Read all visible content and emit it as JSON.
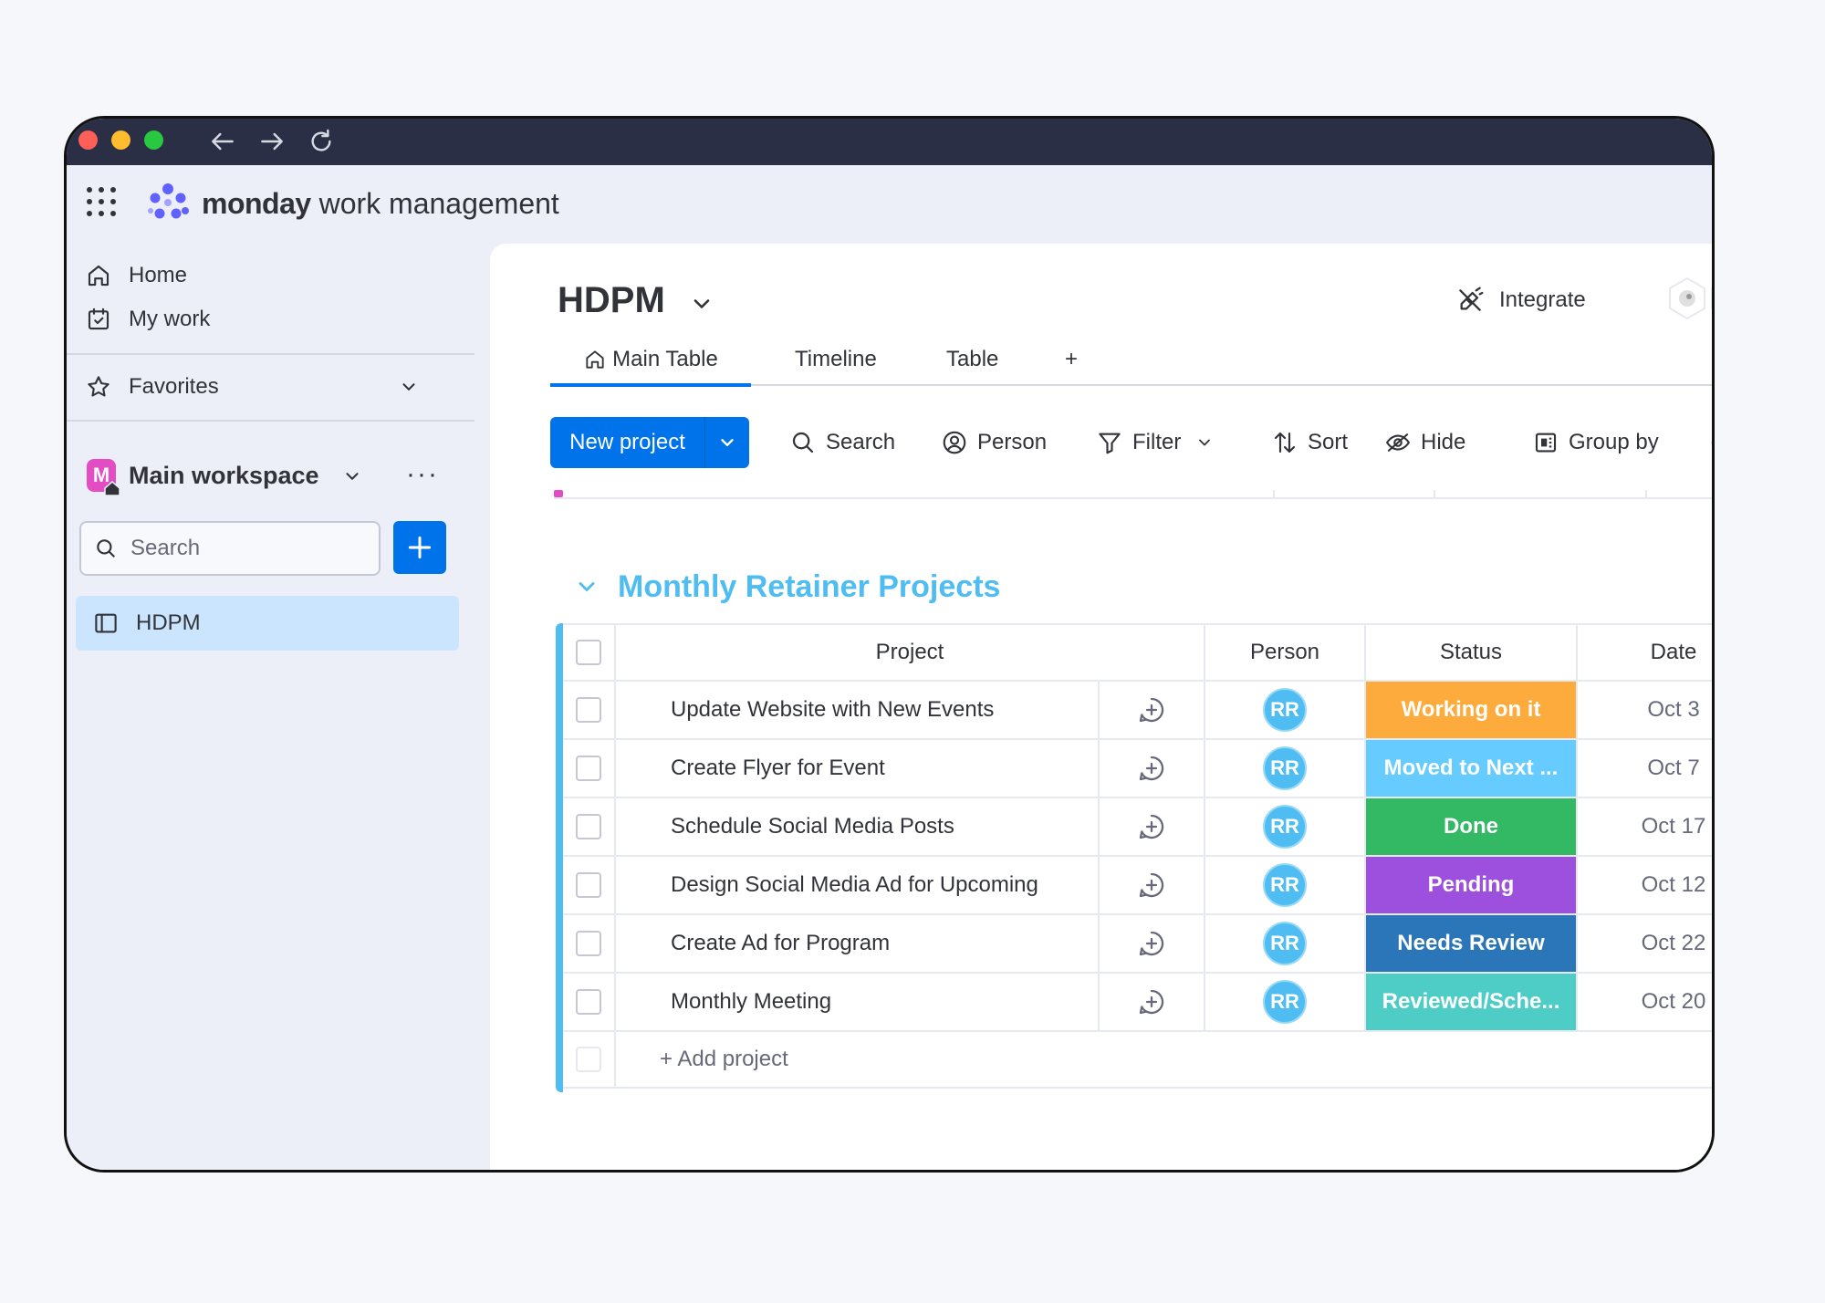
{
  "app": {
    "brand_bold": "monday",
    "brand_rest": " work management"
  },
  "sidebar": {
    "home": "Home",
    "my_work": "My work",
    "favorites": "Favorites",
    "workspace": {
      "initial": "M",
      "name": "Main workspace",
      "more": "···"
    },
    "search_placeholder": "Search",
    "board": "HDPM"
  },
  "board": {
    "title": "HDPM",
    "integrate": "Integrate",
    "tabs": [
      {
        "label": "Main Table",
        "active": true
      },
      {
        "label": "Timeline",
        "active": false
      },
      {
        "label": "Table",
        "active": false
      },
      {
        "label": "+",
        "active": false
      }
    ]
  },
  "toolbar": {
    "new_project": "New project",
    "search": "Search",
    "person": "Person",
    "filter": "Filter",
    "sort": "Sort",
    "hide": "Hide",
    "group_by": "Group by",
    "more": "···"
  },
  "group": {
    "title": "Monthly Retainer Projects",
    "color": "#4fbcf2",
    "columns": {
      "project": "Project",
      "person": "Person",
      "status": "Status",
      "date": "Date"
    },
    "rows": [
      {
        "project": "Update Website with New Events",
        "person": "RR",
        "status": "Working on it",
        "status_color": "#fdab3d",
        "date": "Oct 3"
      },
      {
        "project": "Create Flyer for Event",
        "person": "RR",
        "status": "Moved to Next ...",
        "status_color": "#66ccff",
        "date": "Oct 7"
      },
      {
        "project": "Schedule Social Media Posts",
        "person": "RR",
        "status": "Done",
        "status_color": "#33b864",
        "date": "Oct 17"
      },
      {
        "project": "Design Social Media Ad for Upcoming",
        "person": "RR",
        "status": "Pending",
        "status_color": "#9d50dd",
        "date": "Oct 12"
      },
      {
        "project": "Create Ad for Program",
        "person": "RR",
        "status": "Needs Review",
        "status_color": "#2b76b9",
        "date": "Oct 22"
      },
      {
        "project": "Monthly Meeting",
        "person": "RR",
        "status": "Reviewed/Sche...",
        "status_color": "#4eccc6",
        "date": "Oct 20"
      }
    ],
    "add_row": "+ Add project",
    "summary_colors": [
      "#33b864",
      "#fdab3d",
      "#2b76b9",
      "#9d50dd",
      "#66ccff",
      "#4eccc6"
    ]
  },
  "icons": {
    "apps": "grid-icon",
    "logo": "monday-logo-icon",
    "home": "home-icon",
    "my_work": "calendar-check-icon",
    "favorites": "star-icon",
    "search": "search-icon",
    "add": "plus-icon",
    "board": "board-icon",
    "integrate": "integrate-icon",
    "person": "person-icon",
    "filter": "filter-icon",
    "sort": "sort-icon",
    "hide": "eye-off-icon",
    "group_by": "group-by-icon",
    "update": "add-update-icon"
  }
}
